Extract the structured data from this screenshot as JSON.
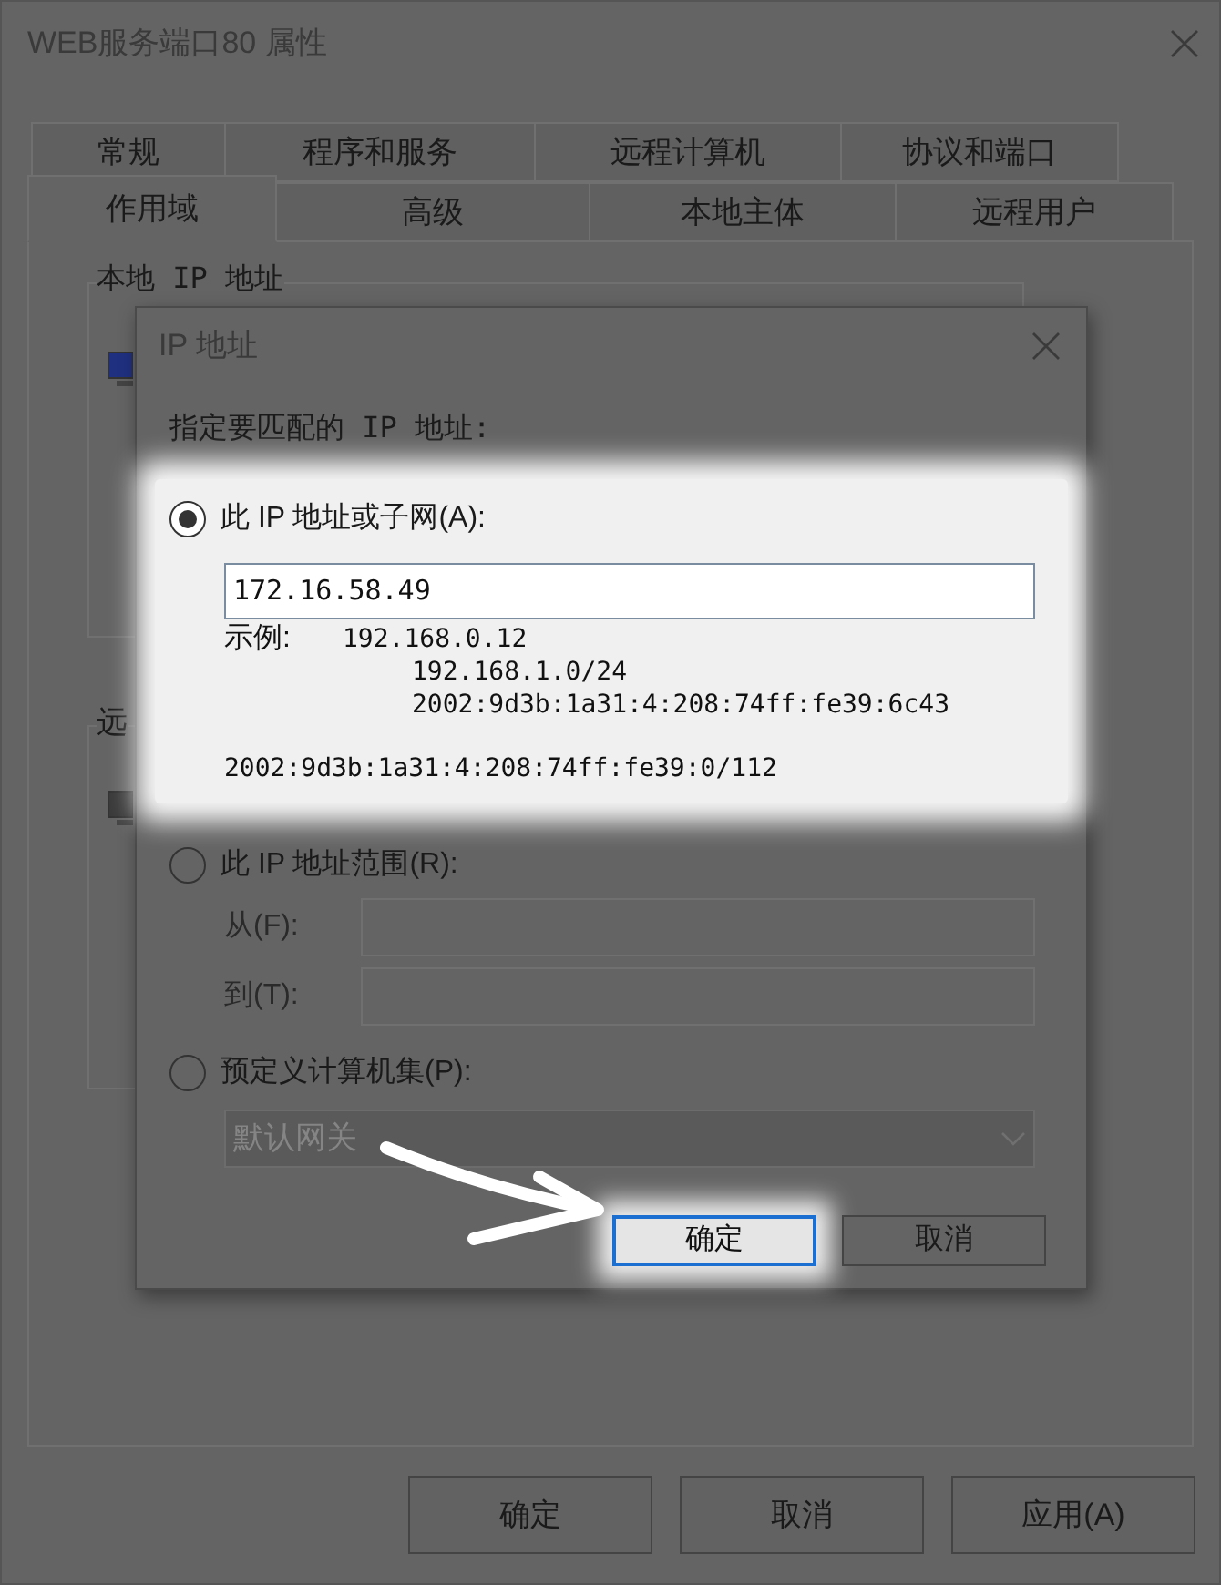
{
  "window": {
    "title": "WEB服务端口80 属性"
  },
  "tabs": [
    [
      {
        "label": "常规",
        "selected": false
      },
      {
        "label": "程序和服务",
        "selected": false
      },
      {
        "label": "远程计算机",
        "selected": false
      },
      {
        "label": "协议和端口",
        "selected": false
      }
    ],
    [
      {
        "label": "作用域",
        "selected": true
      },
      {
        "label": "高级",
        "selected": false
      },
      {
        "label": "本地主体",
        "selected": false
      },
      {
        "label": "远程用户",
        "selected": false
      }
    ]
  ],
  "groups": [
    {
      "label": "本地 IP 地址"
    },
    {
      "label": "远"
    }
  ],
  "buttons": [
    {
      "label": "确定"
    },
    {
      "label": "取消"
    },
    {
      "label": "应用(A)"
    }
  ],
  "dialog": {
    "title": "IP 地址",
    "prompt": "指定要匹配的 IP 地址:",
    "options": [
      {
        "kind": "subnet",
        "label": "此 IP 地址或子网(A):",
        "selected": true,
        "value": "172.16.58.49",
        "example_label": "示例:",
        "examples": [
          "192.168.0.12",
          "192.168.1.0/24",
          "2002:9d3b:1a31:4:208:74ff:fe39:6c43"
        ],
        "example_extra": "2002:9d3b:1a31:4:208:74ff:fe39:0/112"
      },
      {
        "kind": "range",
        "label": "此 IP 地址范围(R):",
        "selected": false,
        "from_label": "从(F):",
        "to_label": "到(T):",
        "disabled": true
      },
      {
        "kind": "preset",
        "label": "预定义计算机集(P):",
        "selected": false,
        "dropdown": "默认网关",
        "disabled": true
      }
    ],
    "buttons": [
      {
        "label": "确定",
        "focused": true
      },
      {
        "label": "取消",
        "focused": false
      }
    ]
  }
}
